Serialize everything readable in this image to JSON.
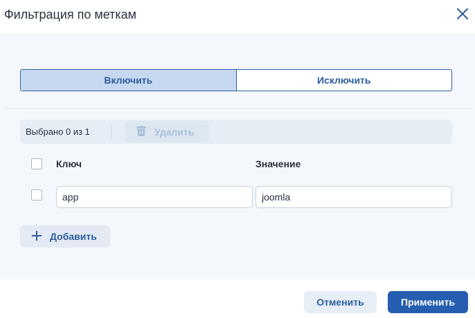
{
  "dialog": {
    "title": "Фильтрация по меткам",
    "close_icon": "close-icon"
  },
  "mode": {
    "options": [
      "Включить",
      "Исключить"
    ],
    "selected": "Включить"
  },
  "toolbar": {
    "selected_text": "Выбрано 0 из 1",
    "delete_label": "Удалить",
    "delete_icon": "trash-icon",
    "delete_enabled": false
  },
  "table": {
    "columns": [
      "Ключ",
      "Значение"
    ],
    "rows": [
      {
        "key": "app",
        "value": "joomla",
        "checked": false
      }
    ],
    "header_checked": false
  },
  "add": {
    "label": "Добавить",
    "icon": "plus-icon"
  },
  "footer": {
    "cancel_label": "Отменить",
    "apply_label": "Применить"
  },
  "colors": {
    "accent": "#255eb0",
    "active_segment": "#c6d9f0",
    "background": "#f4f7fb"
  }
}
